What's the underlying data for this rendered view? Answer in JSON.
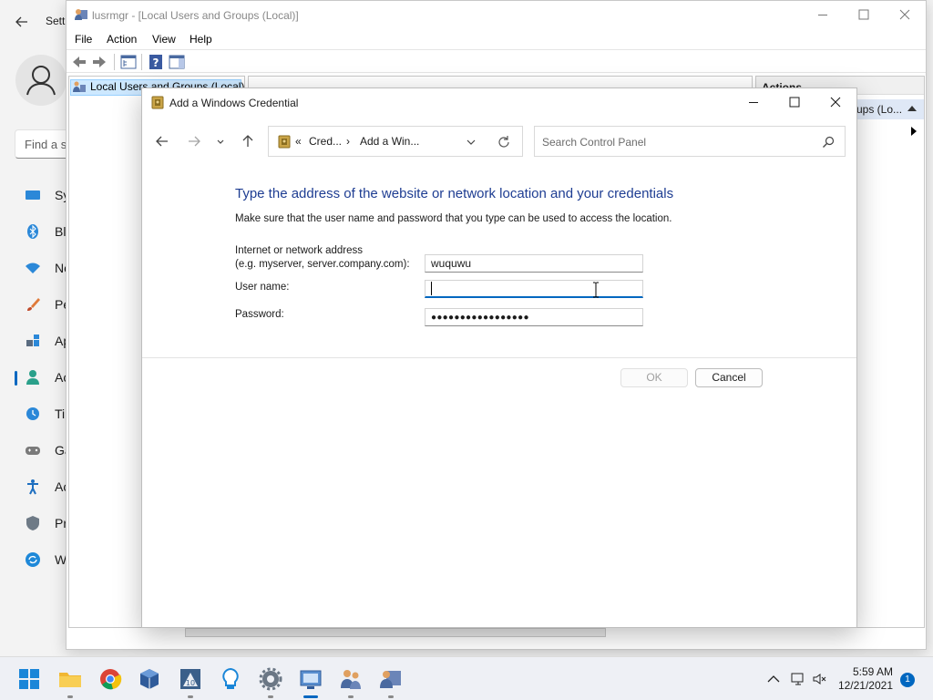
{
  "settings": {
    "title": "Setti",
    "search_placeholder": "Find a s",
    "nav_items": [
      {
        "label": "Sy",
        "icon": "system-icon"
      },
      {
        "label": "Bl",
        "icon": "bluetooth-icon"
      },
      {
        "label": "Ne",
        "icon": "network-icon"
      },
      {
        "label": "Pe",
        "icon": "personalization-icon"
      },
      {
        "label": "Ap",
        "icon": "apps-icon"
      },
      {
        "label": "Ac",
        "icon": "accounts-icon"
      },
      {
        "label": "Ti",
        "icon": "time-icon"
      },
      {
        "label": "Ga",
        "icon": "gaming-icon"
      },
      {
        "label": "Ac",
        "icon": "accessibility-icon"
      },
      {
        "label": "Pr",
        "icon": "privacy-icon"
      },
      {
        "label": "W",
        "icon": "windows-update-icon"
      }
    ]
  },
  "lusrmgr": {
    "title": "lusrmgr - [Local Users and Groups (Local)]",
    "menu": [
      "File",
      "Action",
      "View",
      "Help"
    ],
    "tree_item": "Local Users and Groups (Local)",
    "actions_header": "Actions",
    "actions_sub": "ups (Lo..."
  },
  "dialog": {
    "title": "Add a Windows Credential",
    "breadcrumb": {
      "prefix": "«",
      "item1": "Cred...",
      "separator": "›",
      "item2": "Add a Win..."
    },
    "search_placeholder": "Search Control Panel",
    "heading": "Type the address of the website or network location and your credentials",
    "subtext": "Make sure that the user name and password that you type can be used to access the location.",
    "address_label_line1": "Internet or network address",
    "address_label_line2": "(e.g. myserver, server.company.com):",
    "address_value": "wuquwu",
    "username_label": "User name:",
    "username_value": "",
    "password_label": "Password:",
    "password_value": "●●●●●●●●●●●●●●●●●",
    "ok_label": "OK",
    "cancel_label": "Cancel"
  },
  "taskbar": {
    "apps": [
      "start-icon",
      "file-explorer-icon",
      "chrome-icon",
      "virtualbox-icon",
      "app-icon",
      "bulb-icon",
      "settings-gear-icon",
      "control-panel-icon",
      "users-icon",
      "lusrmgr-icon"
    ],
    "time": "5:59 AM",
    "date": "12/21/2021",
    "notification_count": "1"
  },
  "colors": {
    "accent": "#0067c0",
    "heading": "#1e3d92"
  }
}
